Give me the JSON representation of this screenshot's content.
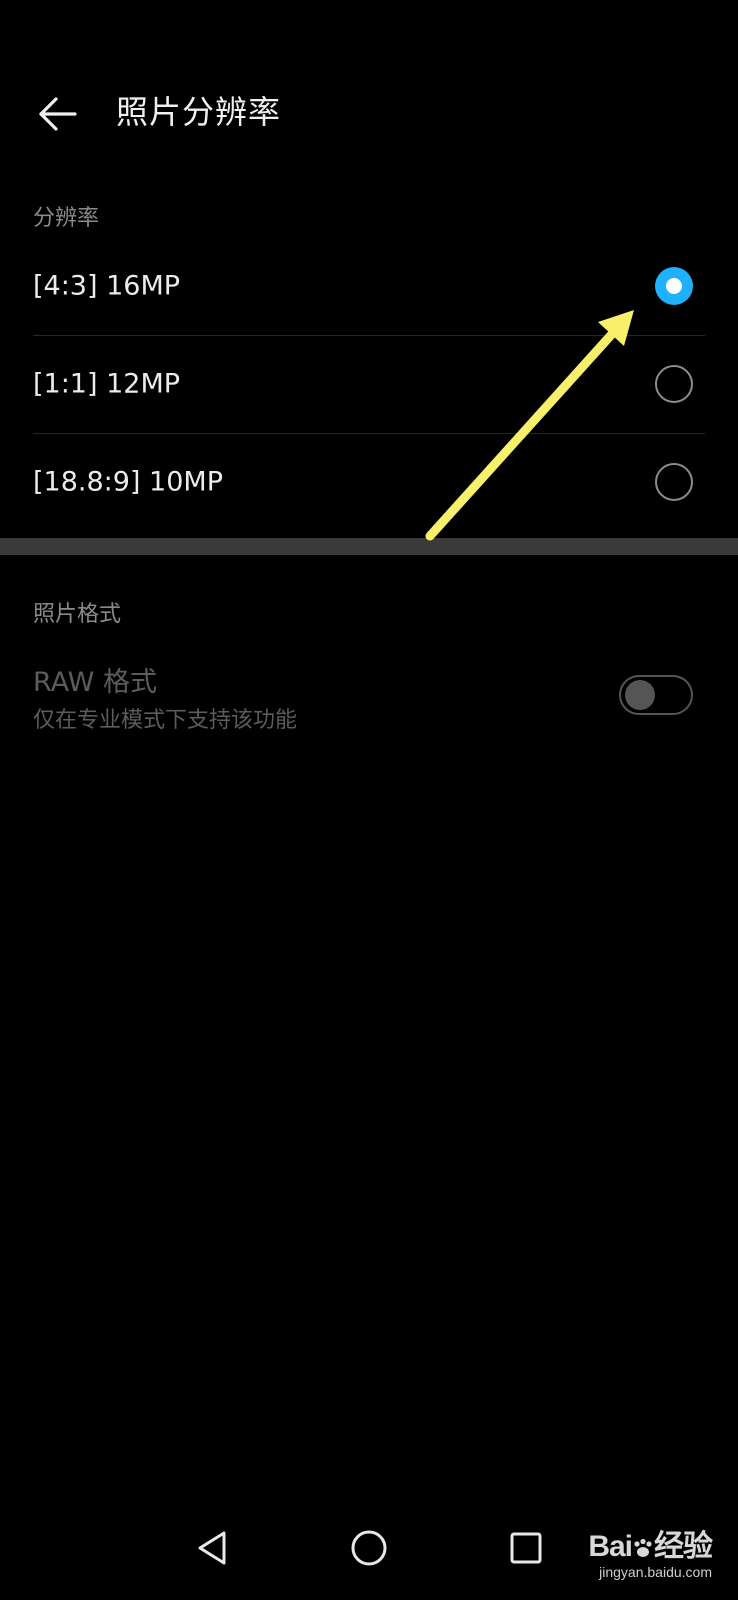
{
  "header": {
    "title": "照片分辨率",
    "back_icon": "arrow-left-icon"
  },
  "resolution_section": {
    "label": "分辨率",
    "options": [
      {
        "label": "[4:3] 16MP",
        "selected": true
      },
      {
        "label": "[1:1] 12MP",
        "selected": false
      },
      {
        "label": "[18.8:9] 10MP",
        "selected": false
      }
    ]
  },
  "format_section": {
    "label": "照片格式",
    "raw": {
      "title": "RAW 格式",
      "subtitle": "仅在专业模式下支持该功能",
      "enabled": false,
      "disabled": true
    }
  },
  "nav_bar": {
    "back_icon": "triangle-back-icon",
    "home_icon": "circle-home-icon",
    "recent_icon": "square-recent-icon"
  },
  "watermark": {
    "logo_left": "Bai",
    "logo_right": "经验",
    "url": "jingyan.baidu.com"
  },
  "colors": {
    "background": "#000000",
    "accent": "#1fb0ff",
    "annotation_arrow": "#f8f06a",
    "separator": "#3a3a3a"
  }
}
